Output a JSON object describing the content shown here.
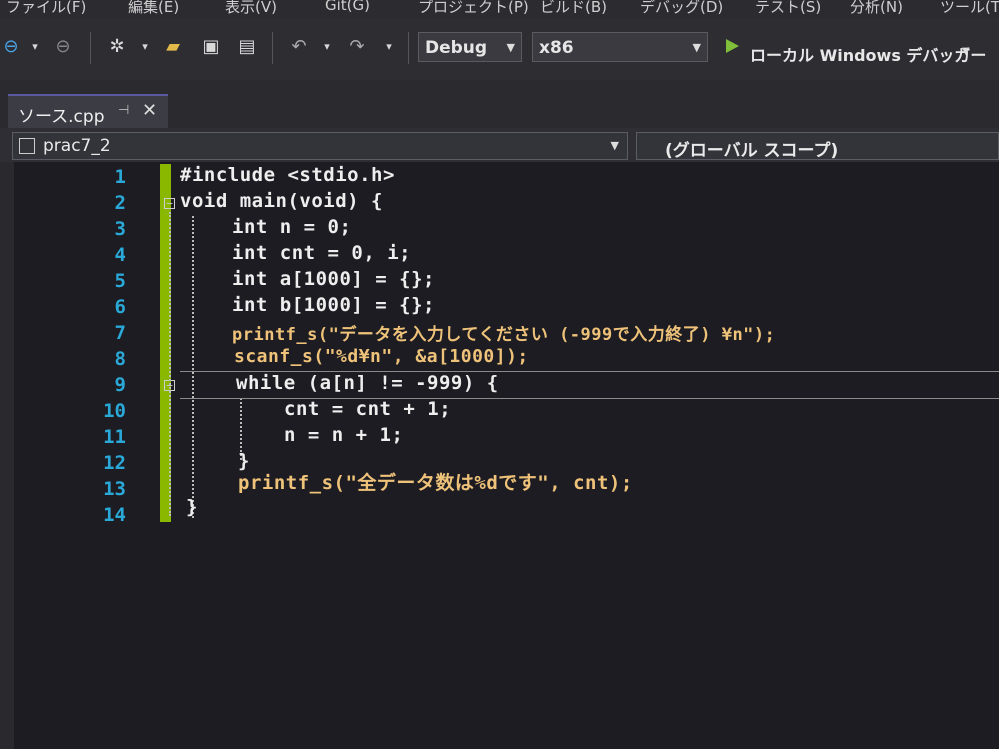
{
  "menu": [
    "ファイル(F)",
    "編集(E)",
    "表示(V)",
    "Git(G)",
    "プロジェクト(P)",
    "ビルド(B)",
    "デバッグ(D)",
    "テスト(S)",
    "分析(N)",
    "ツール(T)"
  ],
  "toolbar": {
    "configuration": "Debug",
    "platform": "x86",
    "run_label": "ローカル Windows デバッガー"
  },
  "tab": {
    "label": "ソース.cpp",
    "pin": "⊣",
    "close": "✕"
  },
  "nav": {
    "project": "prac7_2",
    "scope": "(グローバル スコープ)"
  },
  "editor": {
    "line_numbers": [
      "1",
      "2",
      "3",
      "4",
      "5",
      "6",
      "7",
      "8",
      "9",
      "10",
      "11",
      "12",
      "13",
      "14"
    ],
    "lines": [
      "#include <stdio.h>",
      "void main(void) {",
      "int n = 0;",
      "int cnt = 0, i;",
      "int a[1000] = {};",
      "int b[1000] = {};",
      "printf_s(\"データを入力してください (-999で入力終了) ¥n\");",
      "scanf_s(\"%d¥n\", &a[1000]);",
      "while (a[n] != -999) {",
      "cnt = cnt + 1;",
      "n = n + 1;",
      "}",
      "printf_s(\"全データ数は%dです\", cnt);",
      "}"
    ]
  },
  "colors": {
    "line_number": "#2aa9d8",
    "change_bar": "#8ab800",
    "string": "#efc27a",
    "code": "#eeeeee"
  }
}
